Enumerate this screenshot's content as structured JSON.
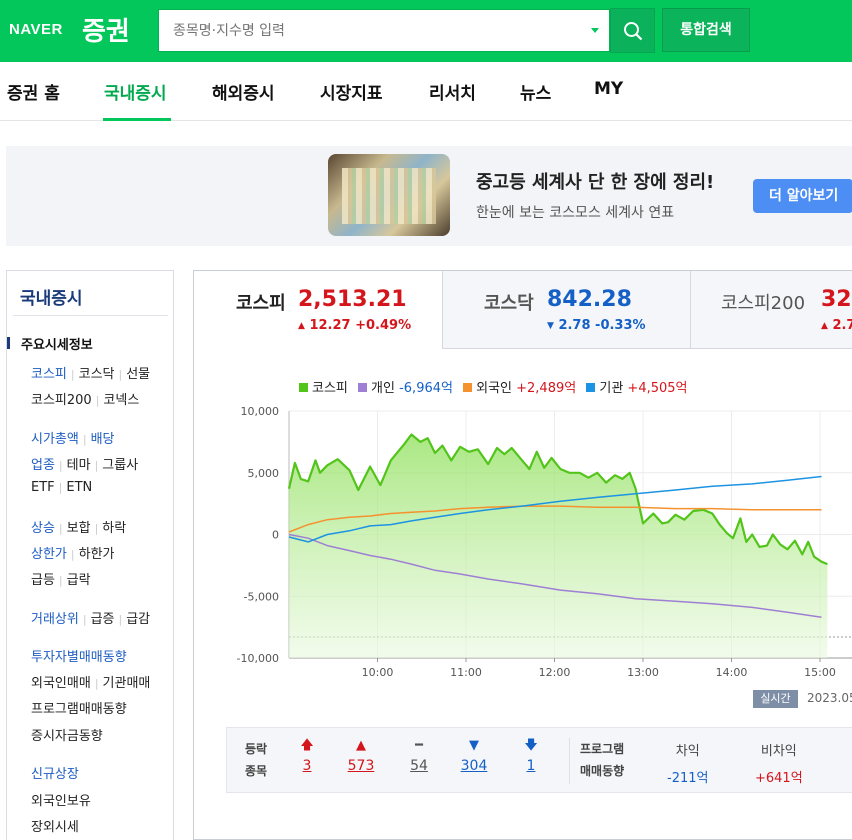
{
  "header": {
    "logo_naver": "NAVER",
    "logo_stock": "증권",
    "search_placeholder": "종목명·지수명 입력",
    "total_search": "통합검색"
  },
  "nav": [
    {
      "label": "증권 홈",
      "active": false
    },
    {
      "label": "국내증시",
      "active": true
    },
    {
      "label": "해외증시",
      "active": false
    },
    {
      "label": "시장지표",
      "active": false
    },
    {
      "label": "리서치",
      "active": false
    },
    {
      "label": "뉴스",
      "active": false
    },
    {
      "label": "MY",
      "active": false
    }
  ],
  "banner": {
    "title": "중고등 세계사 단 한 장에 정리!",
    "subtitle": "한눈에 보는 코스모스 세계사 연표",
    "button": "더 알아보기"
  },
  "sidebar": {
    "title": "국내증시",
    "section": "주요시세정보",
    "rows": [
      [
        {
          "t": "코스피",
          "blue": true
        },
        {
          "t": "코스닥"
        },
        {
          "t": "선물"
        }
      ],
      [
        {
          "t": "코스피200"
        },
        {
          "t": "코넥스"
        }
      ],
      [
        {
          "t": "시가총액",
          "blue": true
        },
        {
          "t": "배당",
          "blue": true
        }
      ],
      [
        {
          "t": "업종",
          "blue": true
        },
        {
          "t": "테마"
        },
        {
          "t": "그룹사"
        }
      ],
      [
        {
          "t": "ETF"
        },
        {
          "t": "ETN"
        }
      ],
      [
        {
          "t": "상승",
          "blue": true
        },
        {
          "t": "보합"
        },
        {
          "t": "하락"
        }
      ],
      [
        {
          "t": "상한가",
          "blue": true
        },
        {
          "t": "하한가"
        }
      ],
      [
        {
          "t": "급등"
        },
        {
          "t": "급락"
        }
      ],
      [
        {
          "t": "거래상위",
          "blue": true
        },
        {
          "t": "급증"
        },
        {
          "t": "급감"
        }
      ],
      [
        {
          "t": "투자자별매매동향",
          "blue": true
        }
      ],
      [
        {
          "t": "외국인매매"
        },
        {
          "t": "기관매매"
        }
      ],
      [
        {
          "t": "프로그램매매동향"
        }
      ],
      [
        {
          "t": "증시자금동향"
        }
      ],
      [
        {
          "t": "신규상장",
          "blue": true
        }
      ],
      [
        {
          "t": "외국인보유"
        }
      ],
      [
        {
          "t": "장외시세"
        }
      ]
    ]
  },
  "tabs": [
    {
      "name": "코스피",
      "value": "2,513.21",
      "direction": "up",
      "arrow": "▲",
      "change": "12.27 +0.49%"
    },
    {
      "name": "코스닥",
      "value": "842.28",
      "direction": "down",
      "arrow": "▼",
      "change": "2.78 -0.33%"
    },
    {
      "name": "코스피200",
      "value": "32",
      "direction": "up",
      "arrow": "▲",
      "change": "2.7"
    }
  ],
  "legend": [
    {
      "name": "코스피",
      "value": "",
      "color": "#52c41a",
      "value_color": ""
    },
    {
      "name": "개인",
      "value": "-6,964억",
      "color": "#9f7fd4",
      "value_color": "#1560c7"
    },
    {
      "name": "외국인",
      "value": "+2,489억",
      "color": "#f5922f",
      "value_color": "#d4161c"
    },
    {
      "name": "기관",
      "value": "+4,505억",
      "color": "#1c93e3",
      "value_color": "#d4161c"
    }
  ],
  "chart_data": {
    "type": "line",
    "x_ticks": [
      "10:00",
      "11:00",
      "12:00",
      "13:00",
      "14:00",
      "15:00"
    ],
    "y_ticks": [
      "10,000",
      "5,000",
      "0",
      "-5,000",
      "-10,000"
    ],
    "ylim": [
      -10000,
      10000
    ],
    "x_unit": "minutes since 09:00",
    "baseline_dashed": -8300,
    "series": [
      {
        "name": "코스피",
        "color": "#52c41a",
        "x": [
          0,
          4,
          8,
          13,
          18,
          21,
          26,
          33,
          41,
          47,
          55,
          62,
          69,
          78,
          83,
          89,
          94,
          99,
          104,
          110,
          116,
          122,
          128,
          135,
          141,
          146,
          151,
          158,
          163,
          168,
          173,
          178,
          184,
          190,
          197,
          203,
          209,
          215,
          221,
          226,
          231,
          235,
          240,
          247,
          253,
          257,
          262,
          268,
          274,
          281,
          287,
          292,
          297,
          301,
          306,
          310,
          314,
          319,
          324,
          328,
          333,
          338,
          343,
          348,
          352,
          356,
          361,
          365
        ],
        "y": [
          3700,
          5800,
          4500,
          4300,
          6000,
          5000,
          5600,
          6100,
          5200,
          3600,
          5500,
          4000,
          6000,
          7300,
          8100,
          7500,
          7800,
          6600,
          7200,
          6000,
          7100,
          6700,
          6900,
          5700,
          7000,
          6500,
          7000,
          6000,
          5300,
          6700,
          5400,
          6200,
          5300,
          5000,
          5000,
          4600,
          5000,
          4200,
          4800,
          4500,
          5000,
          3700,
          900,
          1700,
          900,
          1000,
          1600,
          1200,
          1900,
          2000,
          1700,
          800,
          100,
          -300,
          1300,
          -600,
          0,
          -1000,
          -900,
          0,
          -800,
          -1200,
          -500,
          -1600,
          -600,
          -1800,
          -2200,
          -2400
        ]
      },
      {
        "name": "개인",
        "color": "#9f7fd4",
        "x": [
          0,
          13,
          26,
          41,
          55,
          69,
          83,
          99,
          116,
          135,
          158,
          184,
          209,
          235,
          262,
          287,
          314,
          338,
          361
        ],
        "y": [
          0,
          -300,
          -900,
          -1300,
          -1700,
          -2000,
          -2400,
          -2900,
          -3200,
          -3600,
          -4000,
          -4500,
          -4800,
          -5200,
          -5400,
          -5600,
          -5900,
          -6300,
          -6700
        ]
      },
      {
        "name": "외국인",
        "color": "#f5922f",
        "x": [
          0,
          13,
          26,
          41,
          55,
          69,
          83,
          99,
          116,
          135,
          158,
          184,
          209,
          235,
          262,
          287,
          314,
          338,
          361
        ],
        "y": [
          200,
          800,
          1200,
          1400,
          1500,
          1700,
          1800,
          1900,
          2100,
          2200,
          2300,
          2300,
          2200,
          2200,
          2100,
          2100,
          2000,
          2000,
          2000
        ]
      },
      {
        "name": "기관",
        "color": "#1c93e3",
        "x": [
          0,
          13,
          26,
          41,
          55,
          69,
          83,
          99,
          116,
          135,
          158,
          184,
          209,
          235,
          262,
          287,
          314,
          338,
          361
        ],
        "y": [
          -200,
          -600,
          0,
          300,
          700,
          800,
          1100,
          1400,
          1700,
          2000,
          2300,
          2700,
          3000,
          3300,
          3600,
          3900,
          4100,
          4400,
          4700
        ]
      }
    ]
  },
  "realtime_badge": "실시간",
  "chart_date": "2023.05",
  "breadth": {
    "label1": "등락",
    "label2": "종목",
    "items": [
      {
        "icon": "🡅",
        "icon_name": "upper-limit-icon",
        "value": "3",
        "color": "#d4161c"
      },
      {
        "icon": "▲",
        "icon_name": "rise-icon",
        "value": "573",
        "color": "#d4161c"
      },
      {
        "icon": "━",
        "icon_name": "unchanged-icon",
        "value": "54",
        "color": "#555555"
      },
      {
        "icon": "▼",
        "icon_name": "fall-icon",
        "value": "304",
        "color": "#1560c7"
      },
      {
        "icon": "🡇",
        "icon_name": "lower-limit-icon",
        "value": "1",
        "color": "#1560c7"
      }
    ]
  },
  "program": {
    "label1": "프로그램",
    "label2": "매매동향",
    "cols": [
      {
        "head": "차익",
        "value": "-211억",
        "color": "#1560c7"
      },
      {
        "head": "비차익",
        "value": "+641억",
        "color": "#d4161c"
      }
    ]
  }
}
